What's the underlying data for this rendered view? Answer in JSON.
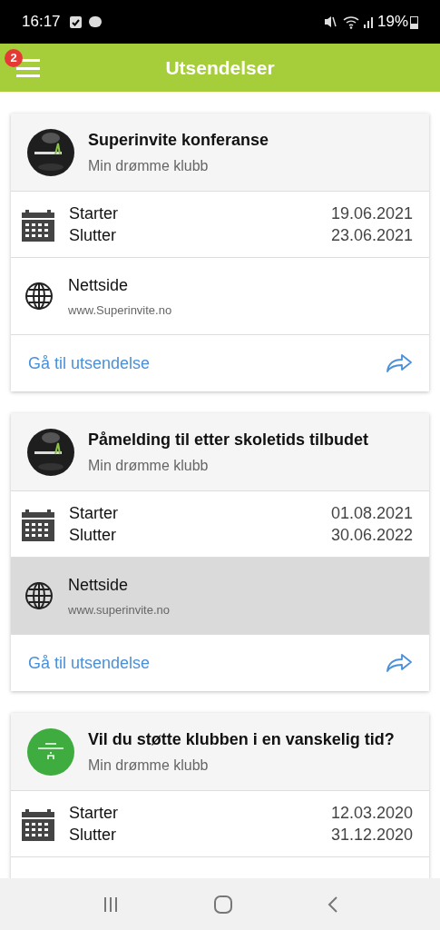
{
  "status_bar": {
    "time": "16:17",
    "battery": "19%"
  },
  "header": {
    "title": "Utsendelser",
    "badge": "2"
  },
  "cards": [
    {
      "kind": "dark",
      "title": "Superinvite konferanse",
      "club": "Min drømme klubb",
      "start_label": "Starter",
      "end_label": "Slutter",
      "start": "19.06.2021",
      "end": "23.06.2021",
      "website": {
        "label": "Nettside",
        "url": "www.Superinvite.no",
        "selected": false
      },
      "link": "Gå til utsendelse"
    },
    {
      "kind": "dark",
      "title": "Påmelding til etter skoletids tilbudet",
      "club": "Min drømme klubb",
      "start_label": "Starter",
      "end_label": "Slutter",
      "start": "01.08.2021",
      "end": "30.06.2022",
      "website": {
        "label": "Nettside",
        "url": "www.superinvite.no",
        "selected": true
      },
      "link": "Gå til utsendelse"
    },
    {
      "kind": "green",
      "title": "Vil du støtte klubben i en vanskelig tid?",
      "club": "Min drømme klubb",
      "start_label": "Starter",
      "end_label": "Slutter",
      "start": "12.03.2020",
      "end": "31.12.2020"
    }
  ]
}
